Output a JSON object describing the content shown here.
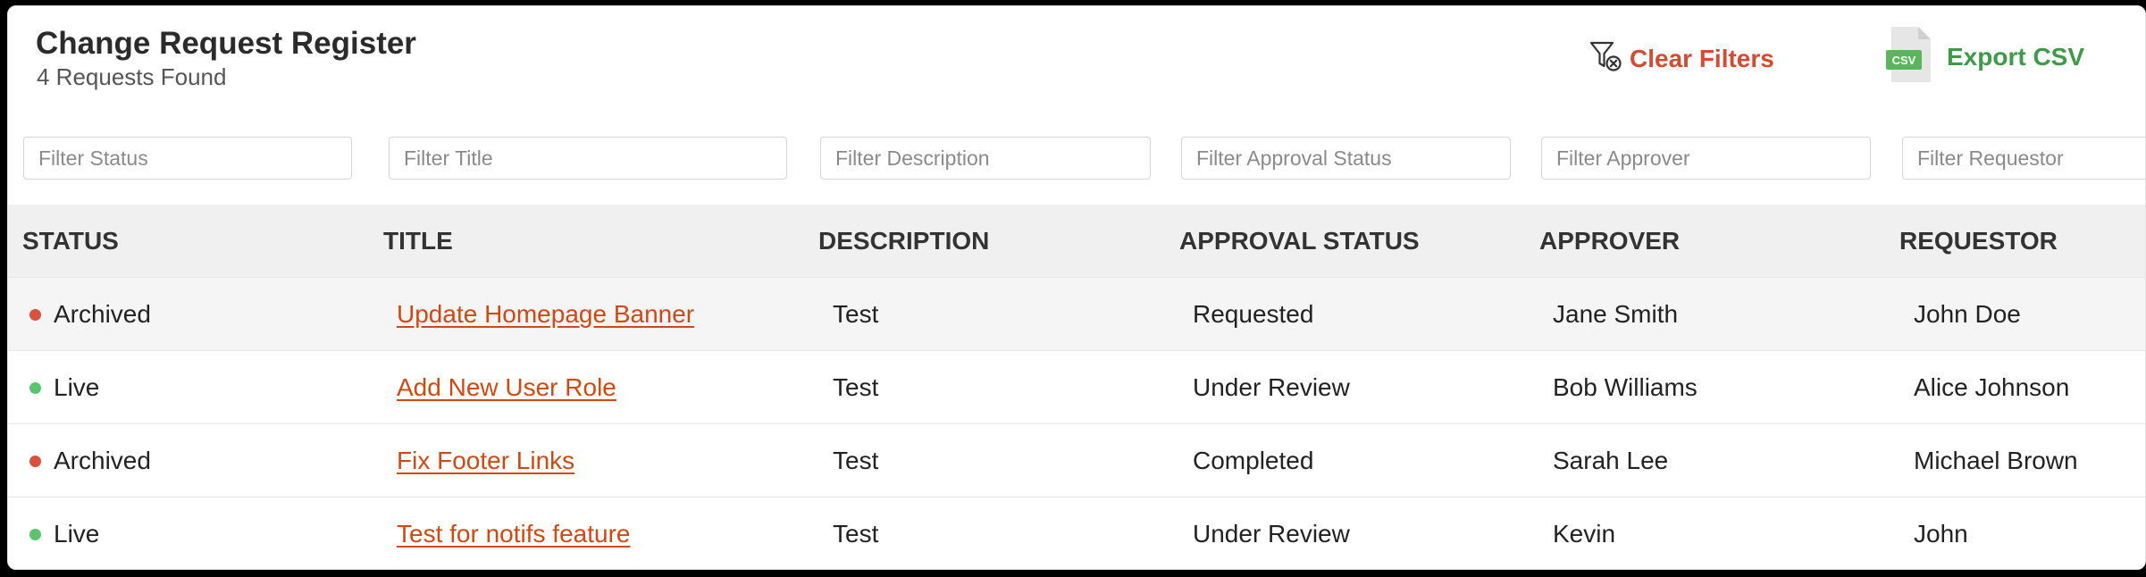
{
  "header": {
    "title": "Change Request Register",
    "subtitle": "4 Requests Found",
    "clear_filters_label": "Clear Filters",
    "export_csv_label": "Export CSV",
    "csv_badge": "CSV"
  },
  "filters": {
    "status_placeholder": "Filter Status",
    "title_placeholder": "Filter Title",
    "description_placeholder": "Filter Description",
    "approval_status_placeholder": "Filter Approval Status",
    "approver_placeholder": "Filter Approver",
    "requestor_placeholder": "Filter Requestor"
  },
  "columns": {
    "status": "STATUS",
    "title": "TITLE",
    "description": "DESCRIPTION",
    "approval_status": "APPROVAL STATUS",
    "approver": "APPROVER",
    "requestor": "REQUESTOR"
  },
  "rows": [
    {
      "status": "Archived",
      "title": "Update Homepage Banner",
      "description": "Test",
      "approval_status": "Requested",
      "approver": "Jane Smith",
      "requestor": "John Doe"
    },
    {
      "status": "Live",
      "title": "Add New User Role",
      "description": "Test",
      "approval_status": "Under Review",
      "approver": "Bob Williams",
      "requestor": "Alice Johnson"
    },
    {
      "status": "Archived",
      "title": "Fix Footer Links",
      "description": "Test",
      "approval_status": "Completed",
      "approver": "Sarah Lee",
      "requestor": "Michael Brown"
    },
    {
      "status": "Live",
      "title": "Test for notifs feature",
      "description": "Test",
      "approval_status": "Under Review",
      "approver": "Kevin",
      "requestor": "John"
    }
  ],
  "colors": {
    "archived": "#d9503f",
    "live": "#5bc46e",
    "link": "#cf4a12",
    "clear_filters": "#d64a2f",
    "export_csv": "#3d9b47"
  },
  "icons": {
    "clear_filters": "filter-clear-icon",
    "export_csv": "csv-file-icon",
    "status_dot": "status-dot-icon"
  }
}
